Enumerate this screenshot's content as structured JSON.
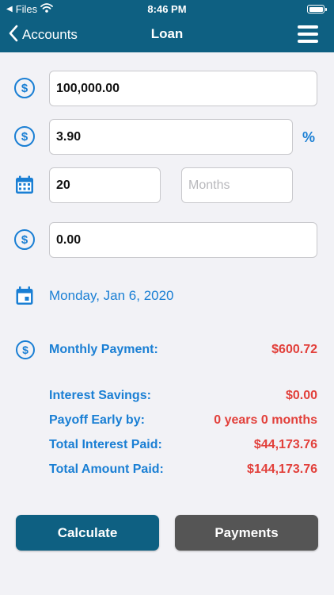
{
  "status_bar": {
    "back_app": "Files",
    "time": "8:46 PM"
  },
  "nav": {
    "back_label": "Accounts",
    "title": "Loan"
  },
  "form": {
    "principal": "100,000.00",
    "rate": "3.90",
    "rate_unit": "%",
    "term_years": "20",
    "term_months_placeholder": "Months",
    "extra_payment": "0.00",
    "start_date": "Monday, Jan 6, 2020"
  },
  "results": {
    "monthly_payment_label": "Monthly Payment:",
    "monthly_payment_value": "$600.72",
    "interest_savings_label": "Interest Savings:",
    "interest_savings_value": "$0.00",
    "payoff_early_label": "Payoff Early by:",
    "payoff_early_value": "0 years 0 months",
    "total_interest_label": "Total Interest Paid:",
    "total_interest_value": "$44,173.76",
    "total_amount_label": "Total Amount Paid:",
    "total_amount_value": "$144,173.76"
  },
  "buttons": {
    "calculate": "Calculate",
    "payments": "Payments"
  },
  "colors": {
    "header": "#0e6082",
    "accent_blue": "#1a7fd4",
    "value_red": "#e2403b",
    "calculate_button": "#0e6082",
    "payments_button": "#555555"
  },
  "icons": [
    "wifi-icon",
    "battery-icon",
    "chevron-left-icon",
    "menu-icon",
    "dollar-circle-icon",
    "calendar-grid-icon",
    "calendar-icon"
  ]
}
